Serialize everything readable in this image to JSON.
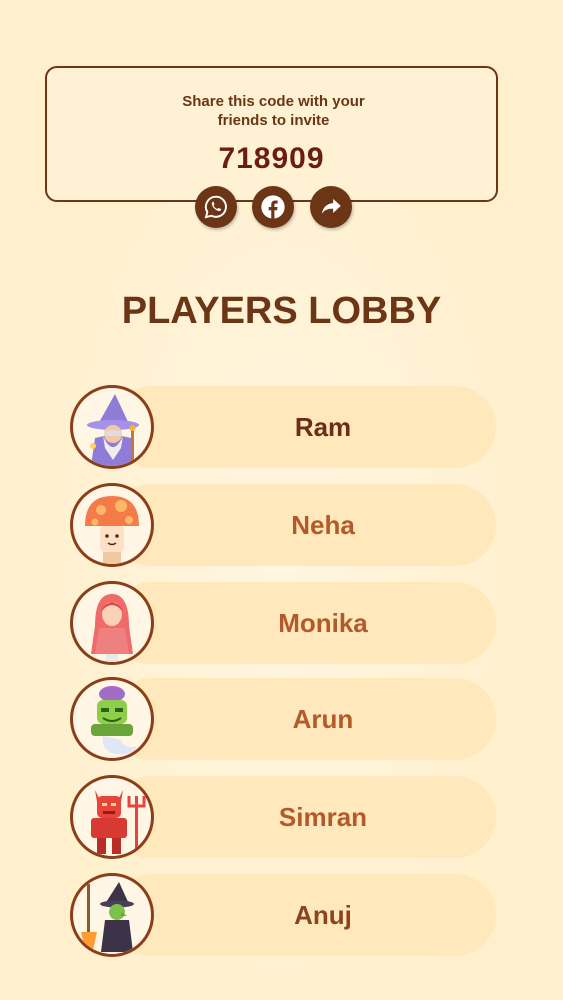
{
  "share": {
    "text": "Share this code with your friends to invite",
    "code": "718909",
    "buttons": [
      {
        "icon": "whatsapp-icon"
      },
      {
        "icon": "facebook-icon"
      },
      {
        "icon": "share-forward-icon"
      }
    ]
  },
  "lobby": {
    "title": "PLAYERS LOBBY",
    "players": [
      {
        "name": "Ram",
        "avatar": "wizard-avatar",
        "color": "#6b2c18"
      },
      {
        "name": "Neha",
        "avatar": "mushroom-avatar",
        "color": "#b35a2a"
      },
      {
        "name": "Monika",
        "avatar": "red-hood-avatar",
        "color": "#b35a2a"
      },
      {
        "name": "Arun",
        "avatar": "genie-avatar",
        "color": "#b35a2a"
      },
      {
        "name": "Simran",
        "avatar": "devil-avatar",
        "color": "#b35a2a"
      },
      {
        "name": "Anuj",
        "avatar": "witch-avatar",
        "color": "#8a4420"
      }
    ]
  },
  "colors": {
    "background": "#fff0cc",
    "accent": "#6b3516",
    "pill": "#ffe8bb"
  }
}
